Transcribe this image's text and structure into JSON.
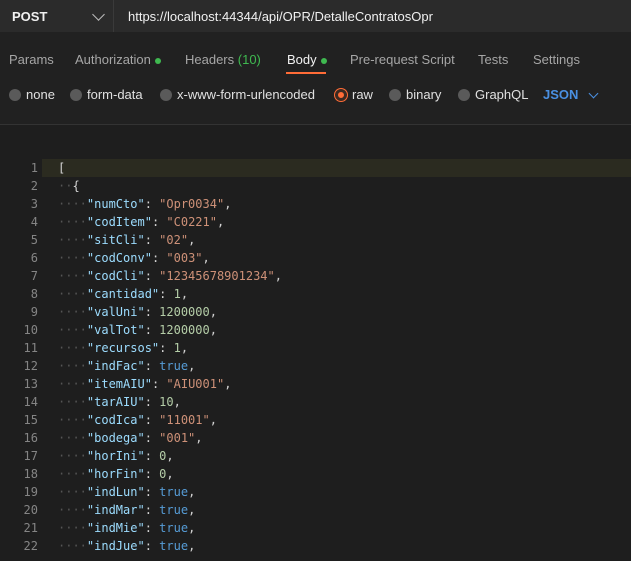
{
  "request": {
    "method": "POST",
    "url": "https://localhost:44344/api/OPR/DetalleContratosOpr"
  },
  "tabs": [
    {
      "label": "Params"
    },
    {
      "label": "Authorization"
    },
    {
      "label": "Headers",
      "count": "(10)"
    },
    {
      "label": "Body"
    },
    {
      "label": "Pre-request Script"
    },
    {
      "label": "Tests"
    },
    {
      "label": "Settings"
    }
  ],
  "body_types": [
    {
      "label": "none"
    },
    {
      "label": "form-data"
    },
    {
      "label": "x-www-form-urlencoded"
    },
    {
      "label": "raw"
    },
    {
      "label": "binary"
    },
    {
      "label": "GraphQL"
    }
  ],
  "body_format": "JSON",
  "editor": {
    "lines": [
      {
        "num": "1",
        "open": "["
      },
      {
        "num": "2",
        "open": "{"
      },
      {
        "num": "3",
        "key": "\"numCto\"",
        "value": "\"Opr0034\"",
        "type": "string"
      },
      {
        "num": "4",
        "key": "\"codItem\"",
        "value": "\"C0221\"",
        "type": "string"
      },
      {
        "num": "5",
        "key": "\"sitCli\"",
        "value": "\"02\"",
        "type": "string"
      },
      {
        "num": "6",
        "key": "\"codConv\"",
        "value": "\"003\"",
        "type": "string"
      },
      {
        "num": "7",
        "key": "\"codCli\"",
        "value": "\"12345678901234\"",
        "type": "string"
      },
      {
        "num": "8",
        "key": "\"cantidad\"",
        "value": "1",
        "type": "number"
      },
      {
        "num": "9",
        "key": "\"valUni\"",
        "value": "1200000",
        "type": "number"
      },
      {
        "num": "10",
        "key": "\"valTot\"",
        "value": "1200000",
        "type": "number"
      },
      {
        "num": "11",
        "key": "\"recursos\"",
        "value": "1",
        "type": "number"
      },
      {
        "num": "12",
        "key": "\"indFac\"",
        "value": "true",
        "type": "bool"
      },
      {
        "num": "13",
        "key": "\"itemAIU\"",
        "value": "\"AIU001\"",
        "type": "string"
      },
      {
        "num": "14",
        "key": "\"tarAIU\"",
        "value": "10",
        "type": "number"
      },
      {
        "num": "15",
        "key": "\"codIca\"",
        "value": "\"11001\"",
        "type": "string"
      },
      {
        "num": "16",
        "key": "\"bodega\"",
        "value": "\"001\"",
        "type": "string"
      },
      {
        "num": "17",
        "key": "\"horIni\"",
        "value": "0",
        "type": "number"
      },
      {
        "num": "18",
        "key": "\"horFin\"",
        "value": "0",
        "type": "number"
      },
      {
        "num": "19",
        "key": "\"indLun\"",
        "value": "true",
        "type": "bool"
      },
      {
        "num": "20",
        "key": "\"indMar\"",
        "value": "true",
        "type": "bool"
      },
      {
        "num": "21",
        "key": "\"indMie\"",
        "value": "true",
        "type": "bool"
      },
      {
        "num": "22",
        "key": "\"indJue\"",
        "value": "true",
        "type": "bool"
      }
    ]
  }
}
